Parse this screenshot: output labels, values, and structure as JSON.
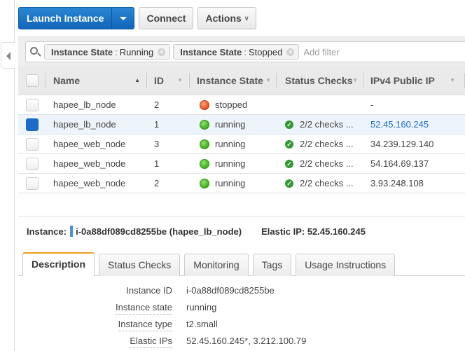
{
  "toolbar": {
    "launch_label": "Launch Instance",
    "connect_label": "Connect",
    "actions_label": "Actions"
  },
  "filter": {
    "tokens": [
      {
        "key": "Instance State",
        "value": "Running"
      },
      {
        "key": "Instance State",
        "value": "Stopped"
      }
    ],
    "placeholder": "Add filter"
  },
  "table": {
    "columns": [
      "Name",
      "ID",
      "Instance State",
      "Status Checks",
      "IPv4 Public IP"
    ],
    "rows": [
      {
        "name": "hapee_lb_node",
        "id": "2",
        "state": "stopped",
        "checks": "",
        "ip": "-",
        "selected": false
      },
      {
        "name": "hapee_lb_node",
        "id": "1",
        "state": "running",
        "checks": "2/2 checks ...",
        "ip": "52.45.160.245",
        "selected": true
      },
      {
        "name": "hapee_web_node",
        "id": "3",
        "state": "running",
        "checks": "2/2 checks ...",
        "ip": "34.239.129.140",
        "selected": false
      },
      {
        "name": "hapee_web_node",
        "id": "1",
        "state": "running",
        "checks": "2/2 checks ...",
        "ip": "54.164.69.137",
        "selected": false
      },
      {
        "name": "hapee_web_node",
        "id": "2",
        "state": "running",
        "checks": "2/2 checks ...",
        "ip": "3.93.248.108",
        "selected": false
      }
    ]
  },
  "detail": {
    "instance_label": "Instance:",
    "instance_value": "i-0a88df089cd8255be (hapee_lb_node)",
    "elastic_ip": "Elastic IP: 52.45.160.245",
    "tabs": [
      "Description",
      "Status Checks",
      "Monitoring",
      "Tags",
      "Usage Instructions"
    ],
    "fields": [
      {
        "label": "Instance ID",
        "value": "i-0a88df089cd8255be"
      },
      {
        "label": "Instance state",
        "value": "running"
      },
      {
        "label": "Instance type",
        "value": "t2.small"
      },
      {
        "label": "Elastic IPs",
        "value": "52.45.160.245*, 3.212.100.79"
      }
    ]
  },
  "colors": {
    "primary": "#1a6cc7",
    "running": "#3fae1c",
    "stopped": "#ec4a1b",
    "active_tab": "#f19c1b"
  }
}
